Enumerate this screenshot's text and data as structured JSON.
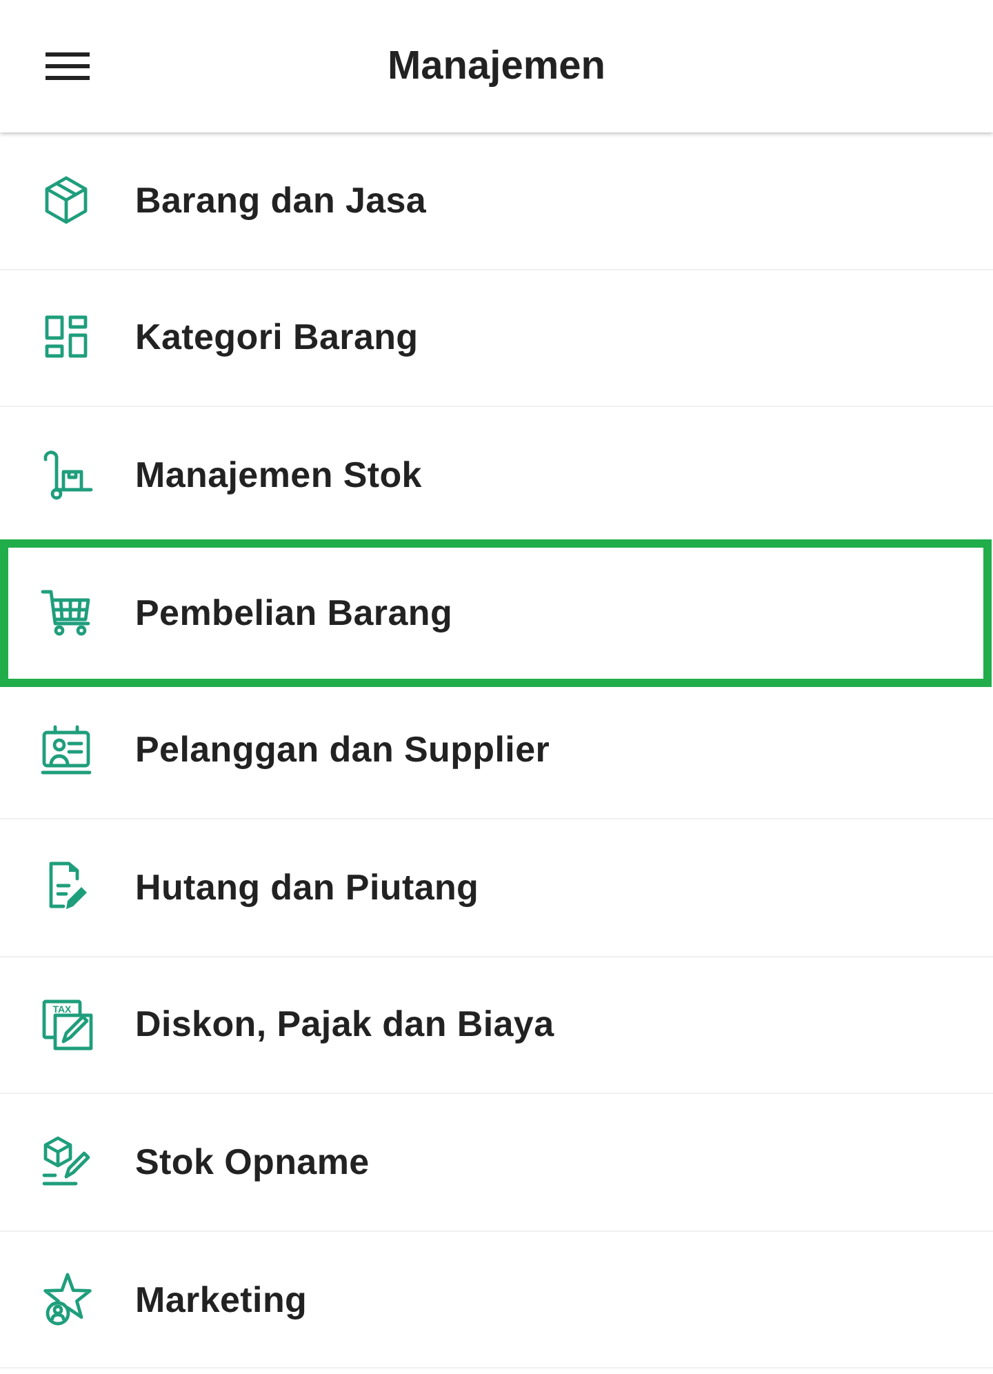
{
  "header": {
    "title": "Manajemen"
  },
  "items": [
    {
      "label": "Barang dan Jasa",
      "kind": "box",
      "highlighted": false
    },
    {
      "label": "Kategori Barang",
      "kind": "grid",
      "highlighted": false
    },
    {
      "label": "Manajemen Stok",
      "kind": "trolley",
      "highlighted": false
    },
    {
      "label": "Pembelian Barang",
      "kind": "cart",
      "highlighted": true
    },
    {
      "label": "Pelanggan dan Supplier",
      "kind": "contact",
      "highlighted": false
    },
    {
      "label": "Hutang dan Piutang",
      "kind": "document",
      "highlighted": false
    },
    {
      "label": "Diskon, Pajak dan Biaya",
      "kind": "tax",
      "icon_text": "TAX",
      "highlighted": false
    },
    {
      "label": "Stok Opname",
      "kind": "boxedit",
      "highlighted": false
    },
    {
      "label": "Marketing",
      "kind": "star",
      "highlighted": false
    }
  ]
}
